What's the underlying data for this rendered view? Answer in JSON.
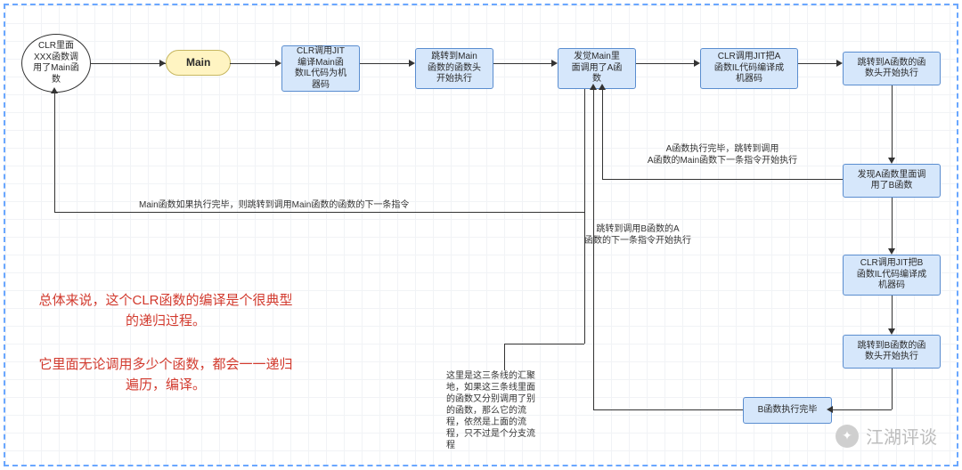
{
  "nodes": {
    "clr_xxx": "CLR里面\nXXX函数调\n用了Main函\n数",
    "main": "Main",
    "jit_main": "CLR调用JIT\n编译Main函\n数IL代码为机\n器码",
    "jump_main": "跳转到Main\n函数的函数头\n开始执行",
    "found_a": "发觉Main里\n面调用了A函\n数",
    "jit_a": "CLR调用JIT把A\n函数IL代码编译成\n机器码",
    "jump_a": "跳转到A函数的函\n数头开始执行",
    "found_b": "发现A函数里面调\n用了B函数",
    "jit_b": "CLR调用JIT把B\n函数IL代码编译成\n机器码",
    "jump_b": "跳转到B函数的函\n数头开始执行",
    "b_done": "B函数执行完毕"
  },
  "labels": {
    "a_done": "A函数执行完毕，跳转到调用\nA函数的Main函数下一条指令开始执行",
    "main_done": "Main函数如果执行完毕，则跳转到调用Main函数的函数的下一条指令",
    "b_back": "跳转到调用B函数的A\n函数的下一条指令开始执行",
    "note": "这里是这三条线的汇聚\n地，如果这三条线里面\n的函数又分别调用了别\n的函数，那么它的流\n程，依然是上面的流\n程，只不过是个分支流\n程"
  },
  "commentary": {
    "l1": "总体来说，这个CLR函数的编译是个很典型\n的递归过程。",
    "l2": "它里面无论调用多少个函数，都会一一递归\n遍历，编译。"
  },
  "watermark": "江湖评谈"
}
